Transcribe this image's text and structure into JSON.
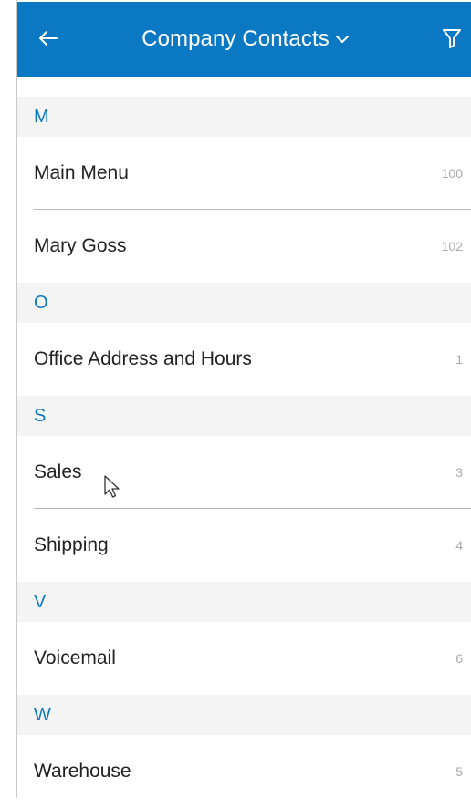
{
  "header": {
    "title": "Company Contacts",
    "icons": {
      "back": "arrow-left-icon",
      "dropdown": "chevron-down-icon",
      "filter": "filter-icon"
    }
  },
  "sections": [
    {
      "letter": "M",
      "contacts": [
        {
          "name": "Main Menu",
          "ext": "100"
        },
        {
          "name": "Mary Goss",
          "ext": "102"
        }
      ]
    },
    {
      "letter": "O",
      "contacts": [
        {
          "name": "Office Address and Hours",
          "ext": "1"
        }
      ]
    },
    {
      "letter": "S",
      "contacts": [
        {
          "name": "Sales",
          "ext": "3"
        },
        {
          "name": "Shipping",
          "ext": "4"
        }
      ]
    },
    {
      "letter": "V",
      "contacts": [
        {
          "name": "Voicemail",
          "ext": "6"
        }
      ]
    },
    {
      "letter": "W",
      "contacts": [
        {
          "name": "Warehouse",
          "ext": "5"
        }
      ]
    }
  ],
  "colors": {
    "accent": "#0a78c2",
    "section_background": "#f4f4f4",
    "extension_text": "#a9a9a9"
  }
}
